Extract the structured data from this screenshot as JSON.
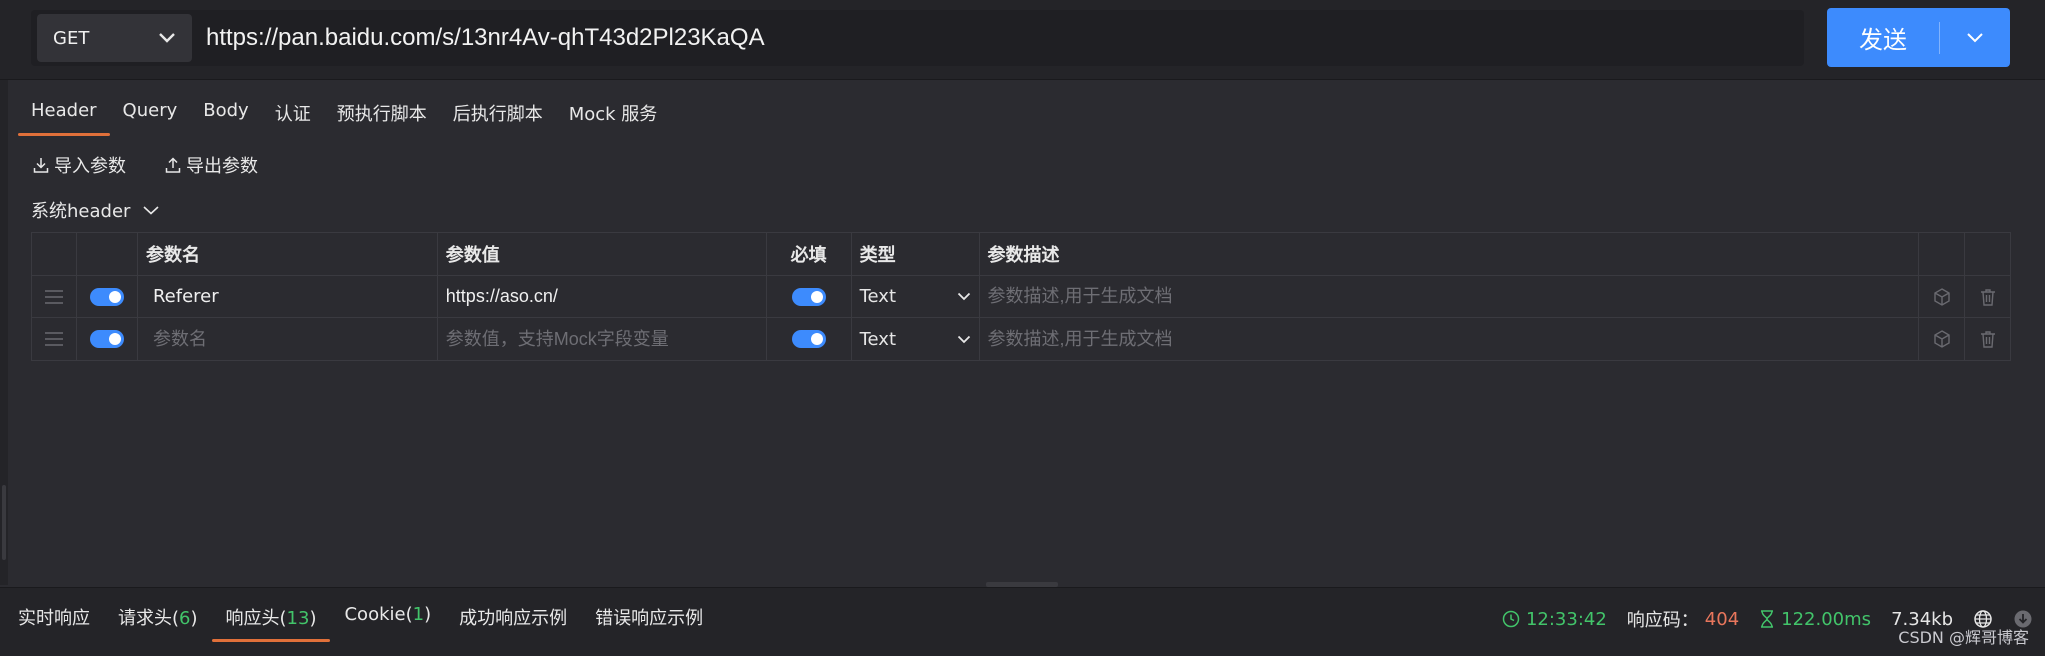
{
  "request": {
    "method": "GET",
    "url": "https://pan.baidu.com/s/13nr4Av-qhT43d2Pl23KaQA",
    "send_label": "发送"
  },
  "tabs": [
    {
      "label": "Header",
      "active": true
    },
    {
      "label": "Query"
    },
    {
      "label": "Body"
    },
    {
      "label": "认证"
    },
    {
      "label": "预执行脚本"
    },
    {
      "label": "后执行脚本"
    },
    {
      "label": "Mock 服务"
    }
  ],
  "actions": {
    "import_label": "导入参数",
    "export_label": "导出参数"
  },
  "system_header_label": "系统header",
  "table": {
    "columns": [
      "参数名",
      "参数值",
      "必填",
      "类型",
      "参数描述"
    ],
    "rows": [
      {
        "name": "Referer",
        "value": "https://aso.cn/",
        "type": "Text",
        "desc_placeholder": "参数描述,用于生成文档",
        "enabled": true,
        "required": true
      },
      {
        "name_placeholder": "参数名",
        "value_placeholder": "参数值，支持Mock字段变量",
        "type": "Text",
        "desc_placeholder": "参数描述,用于生成文档",
        "enabled": true,
        "required": true
      }
    ]
  },
  "bottom_tabs": [
    {
      "label": "实时响应"
    },
    {
      "label": "请求头(",
      "count": "6",
      "suffix": ")"
    },
    {
      "label": "响应头(",
      "count": "13",
      "suffix": ")",
      "active": true
    },
    {
      "label": "Cookie(",
      "count": "1",
      "suffix": ")"
    },
    {
      "label": "成功响应示例"
    },
    {
      "label": "错误响应示例"
    }
  ],
  "status": {
    "time": "12:33:42",
    "code_label": "响应码：",
    "code": "404",
    "duration": "122.00ms",
    "size": "7.34kb"
  },
  "watermark": "CSDN @辉哥博客",
  "colors": {
    "accent": "#3d8bfd",
    "tab_underline": "#e0703a",
    "success": "#42c46a",
    "error": "#e8765c"
  }
}
